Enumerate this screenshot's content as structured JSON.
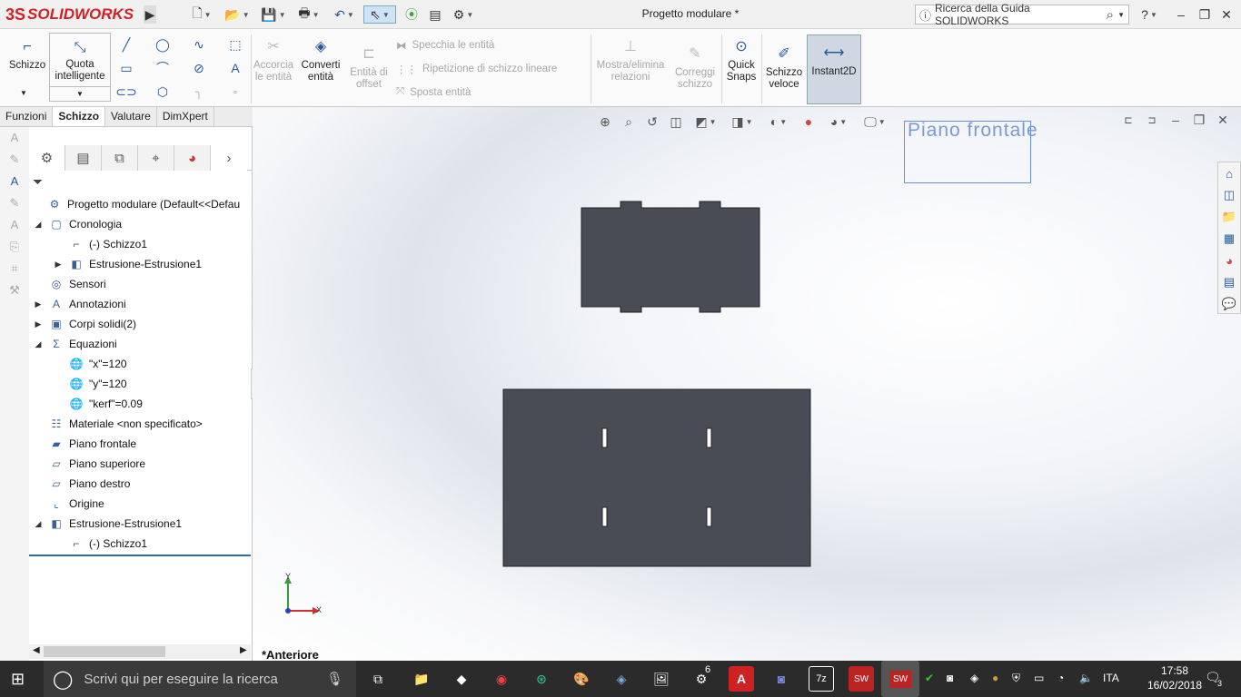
{
  "app": {
    "logo_brand": "SOLIDWORKS",
    "logo_ds": "3S",
    "document_title": "Progetto modulare *"
  },
  "help": {
    "placeholder": "Ricerca della Guida SOLIDWORKS"
  },
  "ribbon": {
    "schizzo": "Schizzo",
    "quota_line1": "Quota",
    "quota_line2": "intelligente",
    "accorcia_line1": "Accorcia",
    "accorcia_line2": "le entità",
    "converti_line1": "Converti",
    "converti_line2": "entità",
    "offset_line1": "Entità di",
    "offset_line2": "offset",
    "specchia": "Specchia le entità",
    "ripetizione": "Ripetizione di schizzo lineare",
    "sposta": "Sposta entità",
    "mostra_line1": "Mostra/elimina",
    "mostra_line2": "relazioni",
    "correggi_line1": "Correggi",
    "correggi_line2": "schizzo",
    "quick_line1": "Quick",
    "quick_line2": "Snaps",
    "veloce_line1": "Schizzo",
    "veloce_line2": "veloce",
    "instant2d": "Instant2D"
  },
  "tabs": [
    "Funzioni",
    "Schizzo",
    "Valutare",
    "DimXpert"
  ],
  "tree": {
    "root": "Progetto modulare  (Default<<Defau",
    "cronologia": "Cronologia",
    "schizzo1_a": "(-) Schizzo1",
    "estrusione_a": "Estrusione-Estrusione1",
    "sensori": "Sensori",
    "annotazioni": "Annotazioni",
    "corpi": "Corpi solidi(2)",
    "equazioni": "Equazioni",
    "eq_x": "\"x\"=120",
    "eq_y": "\"y\"=120",
    "eq_kerf": "\"kerf\"=0.09",
    "materiale": "Materiale <non specificato>",
    "piano_frontale": "Piano frontale",
    "piano_superiore": "Piano superiore",
    "piano_destro": "Piano destro",
    "origine": "Origine",
    "estrusione_b": "Estrusione-Estrusione1",
    "schizzo1_b": "(-) Schizzo1"
  },
  "viewport": {
    "plane_label": "Piano frontale",
    "view_name": "*Anteriore",
    "axis_x": "X",
    "axis_y": "Y"
  },
  "taskbar": {
    "search_placeholder": "Scrivi qui per eseguire la ricerca",
    "language": "ITA",
    "time": "17:58",
    "date": "16/02/2018",
    "notification_count": "3",
    "sw_badge": "6"
  },
  "colors": {
    "part_fill": "#4a4c55",
    "plane_blue": "#7a9ad6",
    "accent": "#27579c",
    "logo_red": "#d32027"
  }
}
